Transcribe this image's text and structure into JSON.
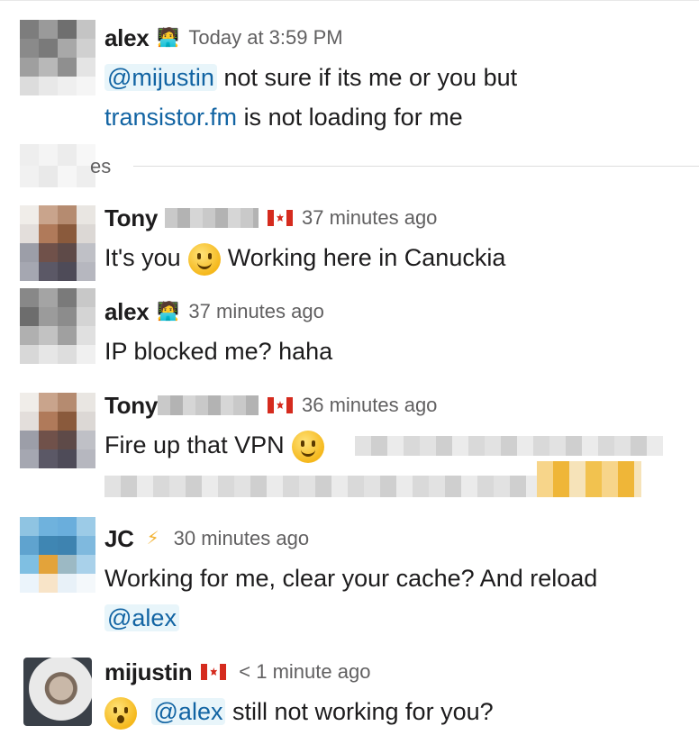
{
  "messages": [
    {
      "author": "alex",
      "status_emoji": "technologist",
      "time": "Today at 3:59 PM",
      "mention": "@mijustin",
      "text1": "not sure if its me or you but",
      "link": "transistor.fm",
      "text2": "is not loading for me"
    },
    {
      "divider_label": "es"
    },
    {
      "author": "Tony",
      "flag": "canada",
      "time": "37 minutes ago",
      "text1": "It's you",
      "text2": "Working here in Canuckia"
    },
    {
      "author": "alex",
      "status_emoji": "technologist",
      "time": "37 minutes ago",
      "text1": "IP blocked me? haha"
    },
    {
      "author": "Tony",
      "flag": "canada",
      "time": "36 minutes ago",
      "text1": "Fire up that VPN"
    },
    {
      "author": "JC",
      "status_emoji": "lightning",
      "time": "30 minutes ago",
      "text1": "Working for me, clear your cache? And reload",
      "mention": "@alex"
    },
    {
      "author": "mijustin",
      "flag": "canada",
      "time": "< 1 minute ago",
      "mention": "@alex",
      "text1": "still not working for you?"
    }
  ],
  "colors": {
    "mention": "#1264a3",
    "mention_bg": "#e8f5fa",
    "time": "#616061",
    "text": "#1d1c1d"
  }
}
